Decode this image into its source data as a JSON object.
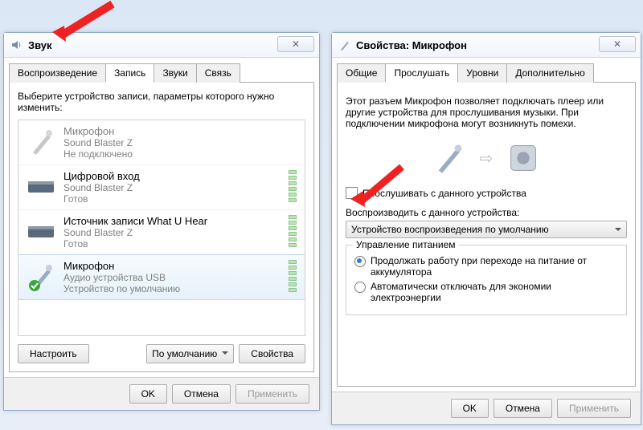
{
  "left": {
    "title": "Звук",
    "tabs": [
      "Воспроизведение",
      "Запись",
      "Звуки",
      "Связь"
    ],
    "activeTab": 1,
    "instruction": "Выберите устройство записи, параметры которого нужно изменить:",
    "devices": [
      {
        "name": "Микрофон",
        "line2": "Sound Blaster Z",
        "line3": "Не подключено",
        "dim": true,
        "meter": false
      },
      {
        "name": "Цифровой вход",
        "line2": "Sound Blaster Z",
        "line3": "Готов",
        "dim": false,
        "meter": true
      },
      {
        "name": "Источник записи What U Hear",
        "line2": "Sound Blaster Z",
        "line3": "Готов",
        "dim": false,
        "meter": true
      },
      {
        "name": "Микрофон",
        "line2": "Аудио устройства USB",
        "line3": "Устройство по умолчанию",
        "dim": false,
        "meter": true,
        "selected": true,
        "check": true
      }
    ],
    "configure": "Настроить",
    "defaultBtn": "По умолчанию",
    "properties": "Свойства",
    "ok": "OK",
    "cancel": "Отмена",
    "apply": "Применить"
  },
  "right": {
    "title": "Свойства: Микрофон",
    "tabs": [
      "Общие",
      "Прослушать",
      "Уровни",
      "Дополнительно"
    ],
    "activeTab": 1,
    "desc": "Этот разъем Микрофон позволяет подключать плеер или другие устройства для прослушивания музыки. При подключении микрофона могут возникнуть помехи.",
    "listenChk": "Прослушивать с данного устройства",
    "playThroughLbl": "Воспроизводить с данного устройства:",
    "playThroughVal": "Устройство воспроизведения по умолчанию",
    "powerGroup": "Управление питанием",
    "radio1": "Продолжать работу при переходе на питание от аккумулятора",
    "radio2": "Автоматически отключать для экономии электроэнергии",
    "ok": "OK",
    "cancel": "Отмена",
    "apply": "Применить"
  }
}
